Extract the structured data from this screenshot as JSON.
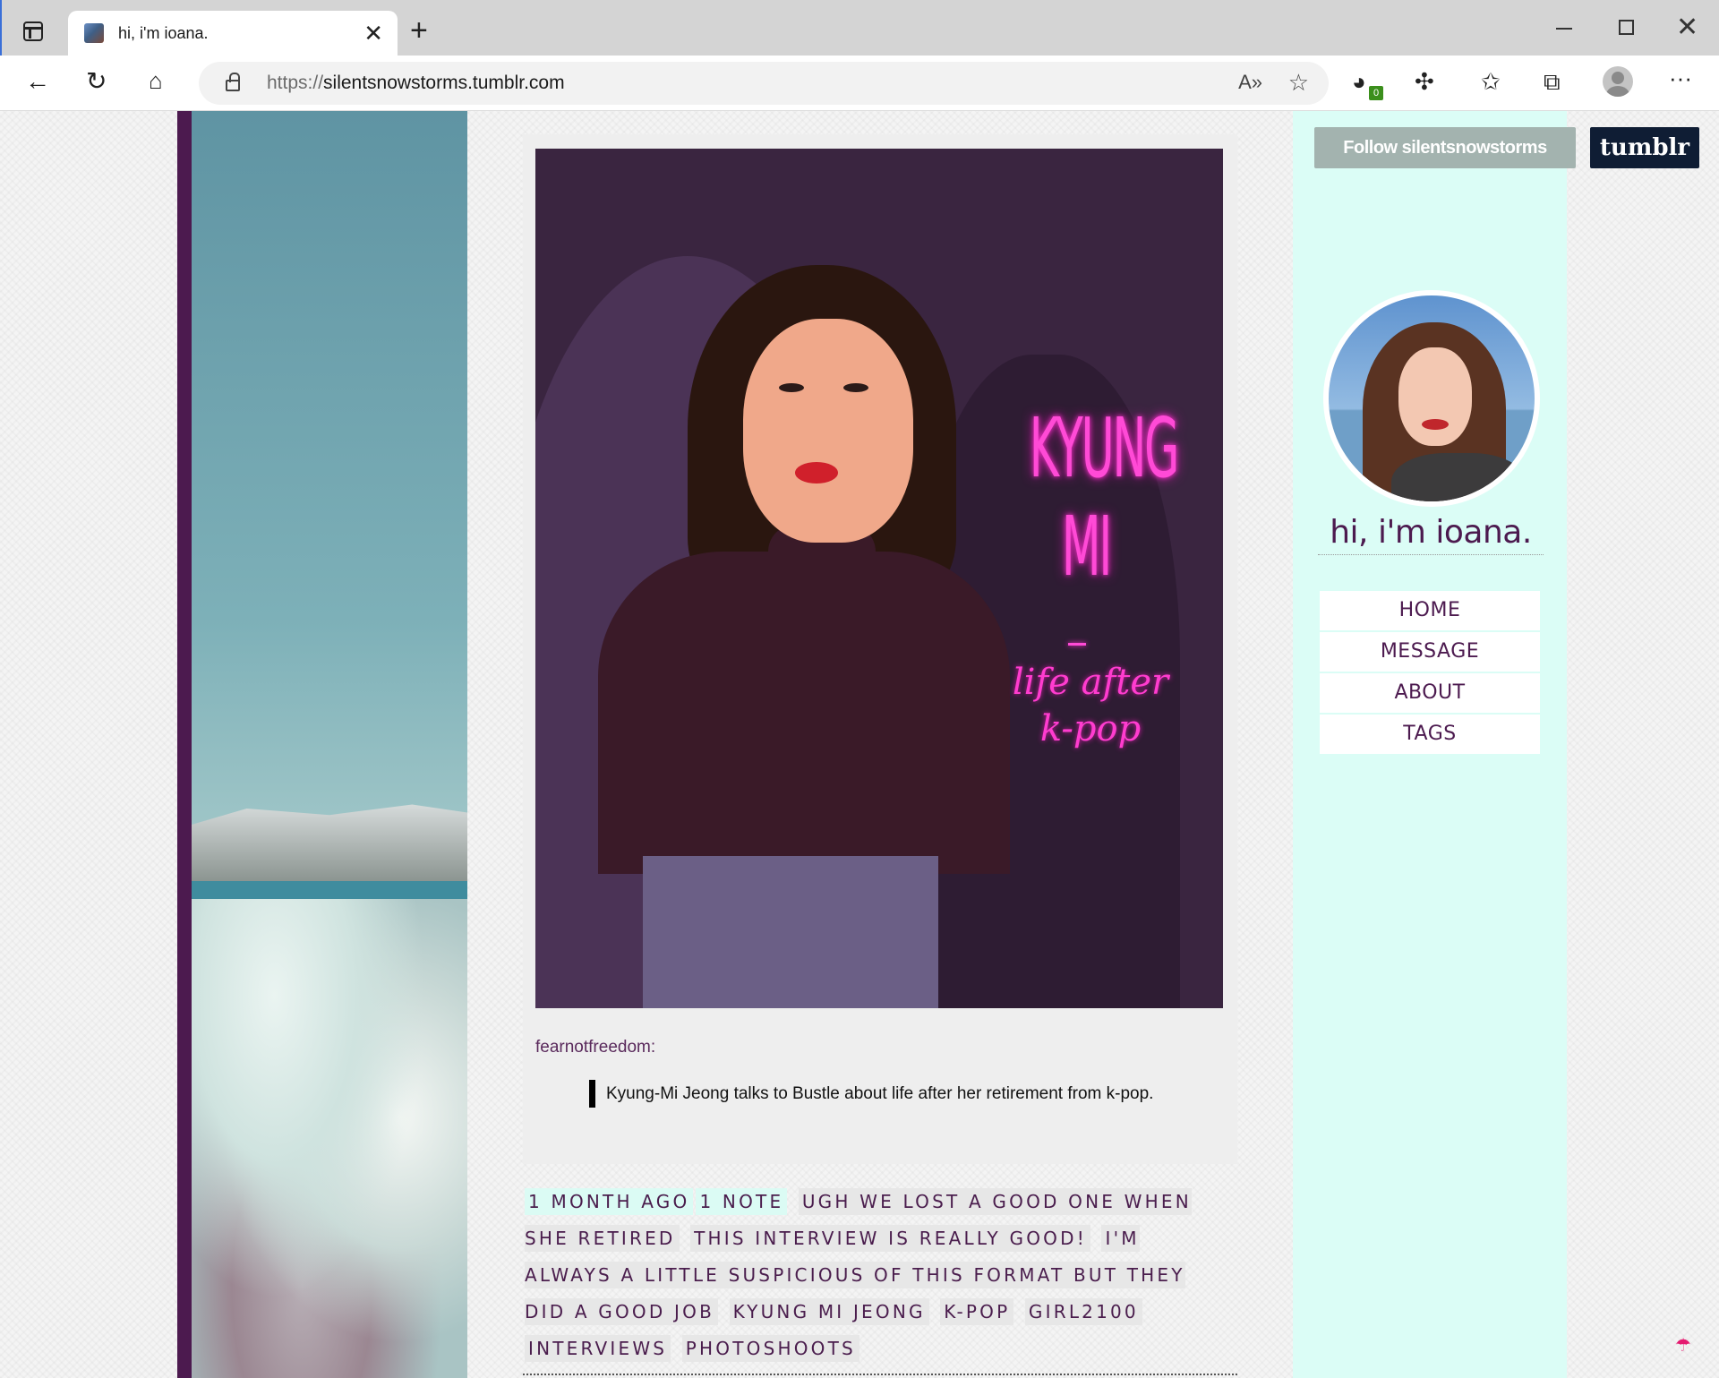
{
  "browser": {
    "tab_title": "hi, i'm ioana.",
    "url_scheme": "https://",
    "url_host": "silentsnowstorms.tumblr.com",
    "extension_badge": "0"
  },
  "blog": {
    "follow_label": "Follow silentsnowstorms",
    "tumblr_label": "tumblr",
    "title": "hi, i'm ioana.",
    "nav": [
      "HOME",
      "MESSAGE",
      "ABOUT",
      "TAGS"
    ]
  },
  "post": {
    "art_title": "KYUNG MI",
    "art_dash": "-",
    "art_subtitle": "life after k-pop",
    "source": "fearnotfreedom",
    "source_suffix": ":",
    "quote": "Kyung-Mi Jeong talks to Bustle about life after her retirement from k-pop.",
    "time": "1 MONTH AGO",
    "notes": "1 NOTE",
    "tags": [
      "UGH WE LOST A GOOD ONE WHEN SHE RETIRED",
      "THIS INTERVIEW IS REALLY GOOD!",
      "I'M ALWAYS A LITTLE SUSPICIOUS OF THIS FORMAT BUT THEY DID A GOOD JOB",
      "KYUNG MI JEONG",
      "K-POP",
      "GIRL2100",
      "INTERVIEWS",
      "PHOTOSHOOTS"
    ]
  },
  "colors": {
    "accent_purple": "#4c1a4f",
    "sidebar_mint": "#dbfdf6",
    "neon_pink": "#ff4ad6",
    "tumblr_navy": "#0f1d34"
  },
  "icons": [
    "tab-actions-icon",
    "close-icon",
    "plus-icon",
    "back-icon",
    "refresh-icon",
    "home-icon",
    "lock-icon",
    "read-aloud-icon",
    "add-favorite-icon",
    "extension-counter-icon",
    "extensions-icon",
    "favorites-icon",
    "collections-icon",
    "profile-icon",
    "more-icon",
    "umbrella-icon"
  ]
}
